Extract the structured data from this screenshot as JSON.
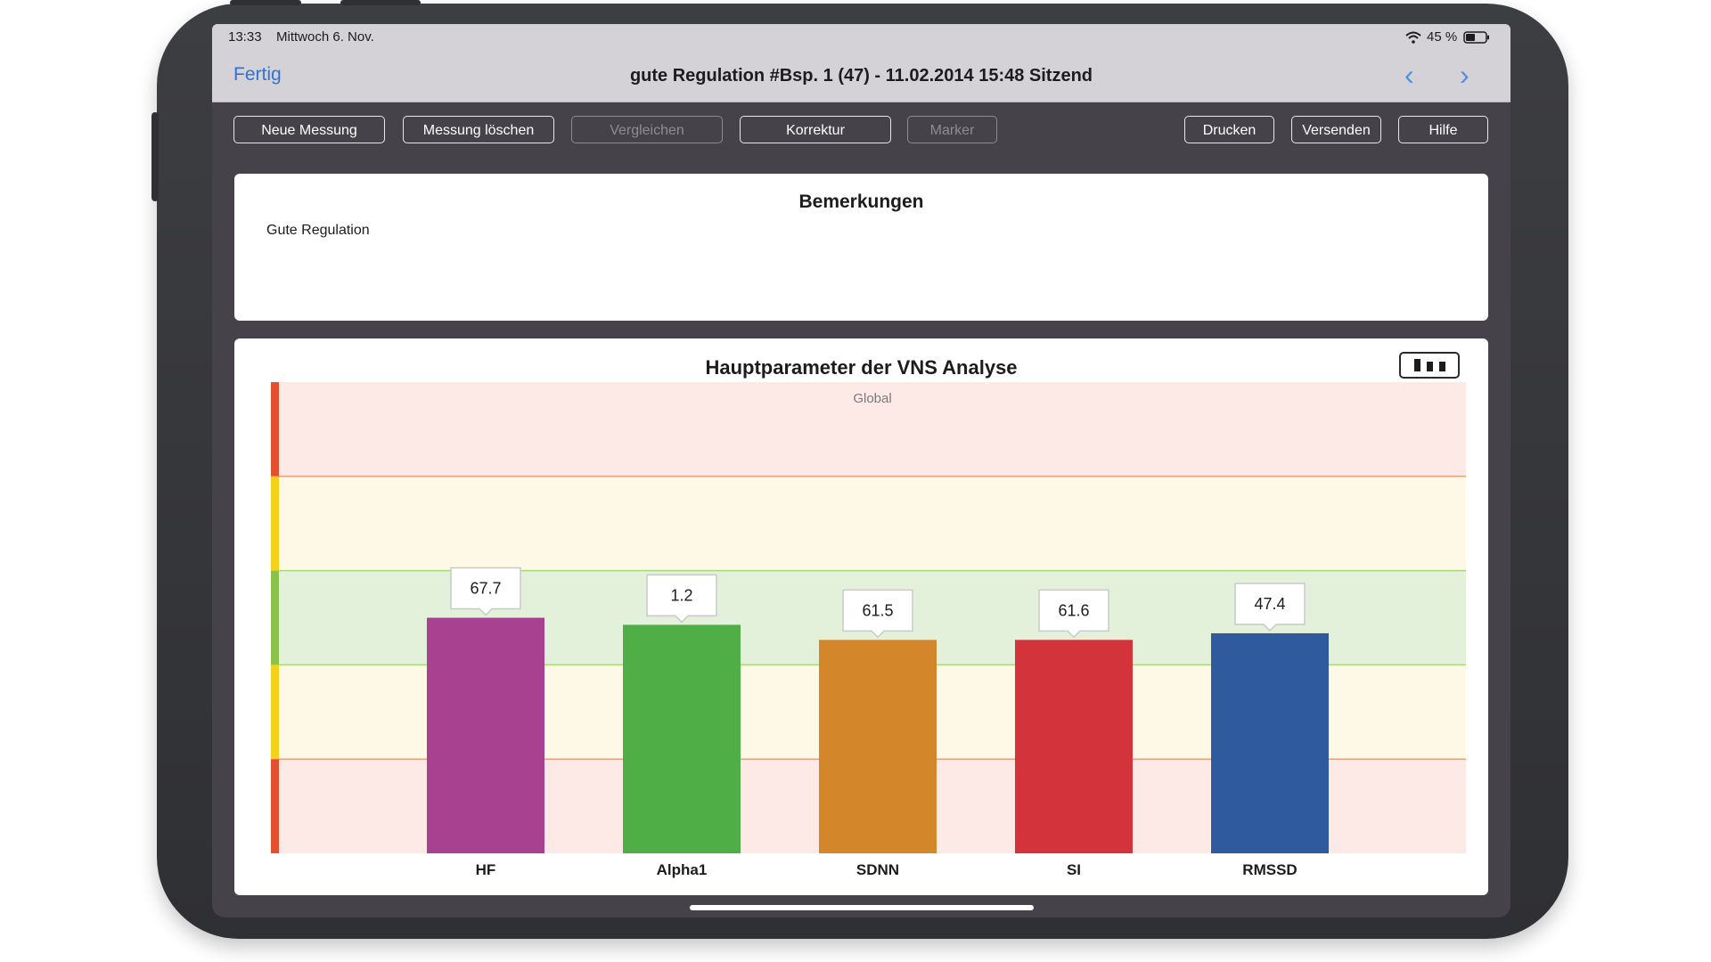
{
  "status_bar": {
    "time": "13:33",
    "date": "Mittwoch 6. Nov.",
    "battery": "45 %"
  },
  "navbar": {
    "done_label": "Fertig",
    "title": "gute Regulation #Bsp. 1 (47) - 11.02.2014 15:48 Sitzend",
    "prev_glyph": "‹",
    "next_glyph": "›"
  },
  "toolbar": {
    "buttons": [
      {
        "label": "Neue Messung",
        "enabled": true
      },
      {
        "label": "Messung löschen",
        "enabled": true
      },
      {
        "label": "Vergleichen",
        "enabled": false
      },
      {
        "label": "Korrektur",
        "enabled": true
      },
      {
        "label": "Marker",
        "enabled": false
      },
      {
        "label": "Drucken",
        "enabled": true
      },
      {
        "label": "Versenden",
        "enabled": true
      },
      {
        "label": "Hilfe",
        "enabled": true
      }
    ]
  },
  "remarks": {
    "title": "Bemerkungen",
    "text": "Gute Regulation"
  },
  "chart": {
    "title": "Hauptparameter der VNS Analyse",
    "view_toggle_icon": "bar-chart-icon"
  },
  "chart_data": {
    "type": "bar",
    "title": "Hauptparameter der VNS Analyse",
    "zone_label": "Global",
    "categories": [
      "HF",
      "Alpha1",
      "SDNN",
      "SI",
      "RMSSD"
    ],
    "values": [
      67.7,
      1.2,
      61.5,
      61.6,
      47.4
    ],
    "display_level": [
      0.5,
      0.485,
      0.453,
      0.453,
      0.467
    ],
    "colors": [
      "#a8418f",
      "#4fae46",
      "#d4862a",
      "#d3333a",
      "#305a9e"
    ],
    "zones": [
      {
        "color": "#fdeae6",
        "edge": "#e3502d"
      },
      {
        "color": "#fef8e6",
        "edge": "#f3d219"
      },
      {
        "color": "#e4f1da",
        "edge": "#8bc34a"
      },
      {
        "color": "#fef8e6",
        "edge": "#f3d219"
      },
      {
        "color": "#fdeae6",
        "edge": "#e3502d"
      }
    ],
    "zone_border_colors": [
      "#e8a07a",
      "#a8d77a",
      "#a8d77a",
      "#e8a07a"
    ],
    "grid": false,
    "legend": "none"
  }
}
